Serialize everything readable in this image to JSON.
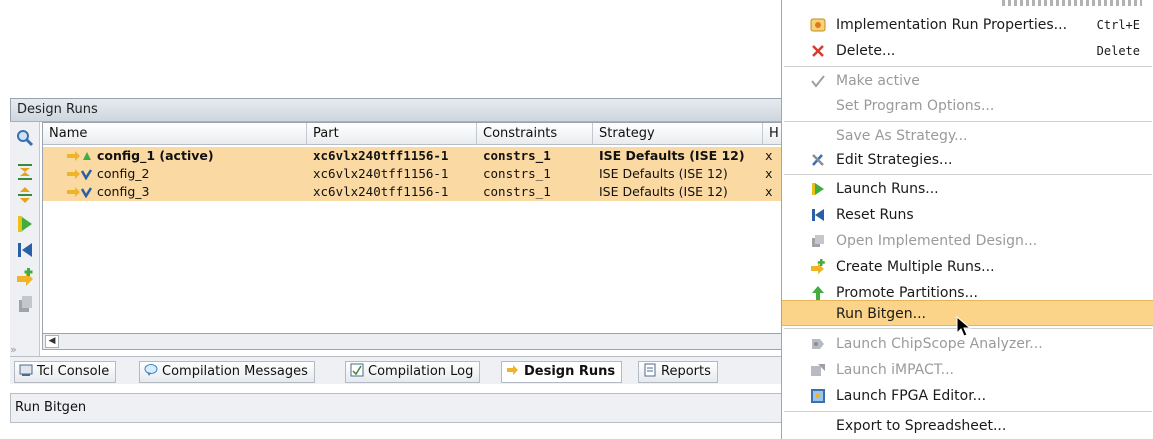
{
  "panel": {
    "title": "Design Runs",
    "columns": [
      "Name",
      "Part",
      "Constraints",
      "Strategy",
      "H"
    ],
    "rows": [
      {
        "name": "config_1 (active)",
        "part": "xc6vlx240tff1156-1",
        "constraints": "constrs_1",
        "strategy": "ISE Defaults (ISE 12)",
        "extra": "x",
        "active": true
      },
      {
        "name": "config_2",
        "part": "xc6vlx240tff1156-1",
        "constraints": "constrs_1",
        "strategy": "ISE Defaults (ISE 12)",
        "extra": "x",
        "active": false
      },
      {
        "name": "config_3",
        "part": "xc6vlx240tff1156-1",
        "constraints": "constrs_1",
        "strategy": "ISE Defaults (ISE 12)",
        "extra": "x",
        "active": false
      }
    ],
    "toolbar_icons": [
      "search-icon",
      "collapse-all-icon",
      "expand-all-icon",
      "launch-run-icon",
      "reset-run-icon",
      "create-runs-icon",
      "open-design-icon"
    ],
    "row_highlight_color": "#fbd9a3"
  },
  "tabs": [
    {
      "label": "Tcl Console",
      "icon": "console-icon",
      "active": false
    },
    {
      "label": "Compilation Messages",
      "icon": "message-bubble-icon",
      "active": false
    },
    {
      "label": "Compilation Log",
      "icon": "log-icon",
      "active": false
    },
    {
      "label": "Design Runs",
      "icon": "design-runs-icon",
      "active": true
    },
    {
      "label": "Reports",
      "icon": "report-icon",
      "active": false
    }
  ],
  "status": {
    "text": "Run Bitgen"
  },
  "menu": {
    "items": [
      {
        "label": "Implementation Run Properties...",
        "shortcut": "Ctrl+E",
        "icon": "properties-icon",
        "enabled": true
      },
      {
        "label": "Delete...",
        "shortcut": "Delete",
        "icon": "delete-icon",
        "enabled": true
      },
      {
        "label": "Make active",
        "icon": "checkmark-icon",
        "enabled": false
      },
      {
        "label": "Set Program Options...",
        "icon": "",
        "enabled": false
      },
      {
        "label": "Save As Strategy...",
        "icon": "",
        "enabled": false
      },
      {
        "label": "Edit Strategies...",
        "icon": "tools-icon",
        "enabled": true
      },
      {
        "label": "Launch Runs...",
        "icon": "launch-icon",
        "enabled": true
      },
      {
        "label": "Reset Runs",
        "icon": "reset-icon",
        "enabled": true
      },
      {
        "label": "Open Implemented Design...",
        "icon": "open-design-icon",
        "enabled": false
      },
      {
        "label": "Create Multiple Runs...",
        "icon": "create-runs-icon",
        "enabled": true
      },
      {
        "label": "Promote Partitions...",
        "icon": "promote-icon",
        "enabled": true
      },
      {
        "label": "Run Bitgen...",
        "icon": "",
        "enabled": true,
        "highlighted": true
      },
      {
        "label": "Launch ChipScope Analyzer...",
        "icon": "chipscope-icon",
        "enabled": false
      },
      {
        "label": "Launch iMPACT...",
        "icon": "impact-icon",
        "enabled": false
      },
      {
        "label": "Launch FPGA Editor...",
        "icon": "fpga-editor-icon",
        "enabled": true
      },
      {
        "label": "Export to Spreadsheet...",
        "icon": "",
        "enabled": true
      }
    ],
    "highlight_color": "#fbd48a"
  }
}
